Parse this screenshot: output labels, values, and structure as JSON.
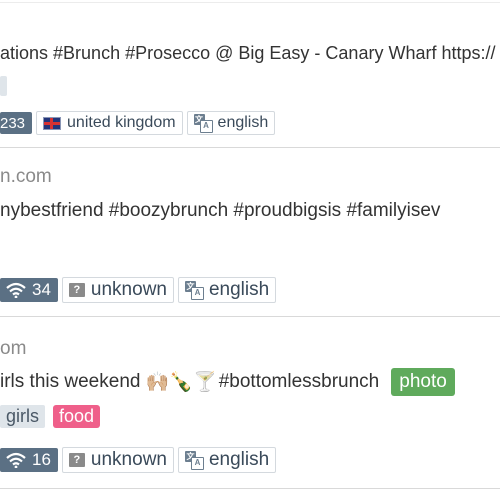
{
  "post1": {
    "text": "ations #Brunch #Prosecco @ Big Easy - Canary Wharf https://",
    "count": "233",
    "country": "united kingdom",
    "language": "english"
  },
  "post2": {
    "username": "n.com",
    "text": "nybestfriend #boozybrunch #proudbigsis #familyisev",
    "count": "34",
    "country": "unknown",
    "language": "english"
  },
  "post3": {
    "username": "om",
    "text_before": "irls this weekend ",
    "emojis": "🙌🏼🍾🍸",
    "text_after": "#bottomlessbrunch",
    "photo_label": "photo",
    "tags": [
      "girls",
      "food"
    ],
    "count": "16",
    "country": "unknown",
    "language": "english"
  },
  "icons": {
    "count_icon": "wifi-icon",
    "country_flag": "uk-flag-icon",
    "unknown_flag": "question-flag-icon",
    "language_icon": "translate-icon"
  },
  "colors": {
    "count_badge": "#5b7084",
    "food_tag": "#ef5f8a",
    "photo_tag": "#5faa5c",
    "neutral_tag": "#dfe5ea"
  }
}
